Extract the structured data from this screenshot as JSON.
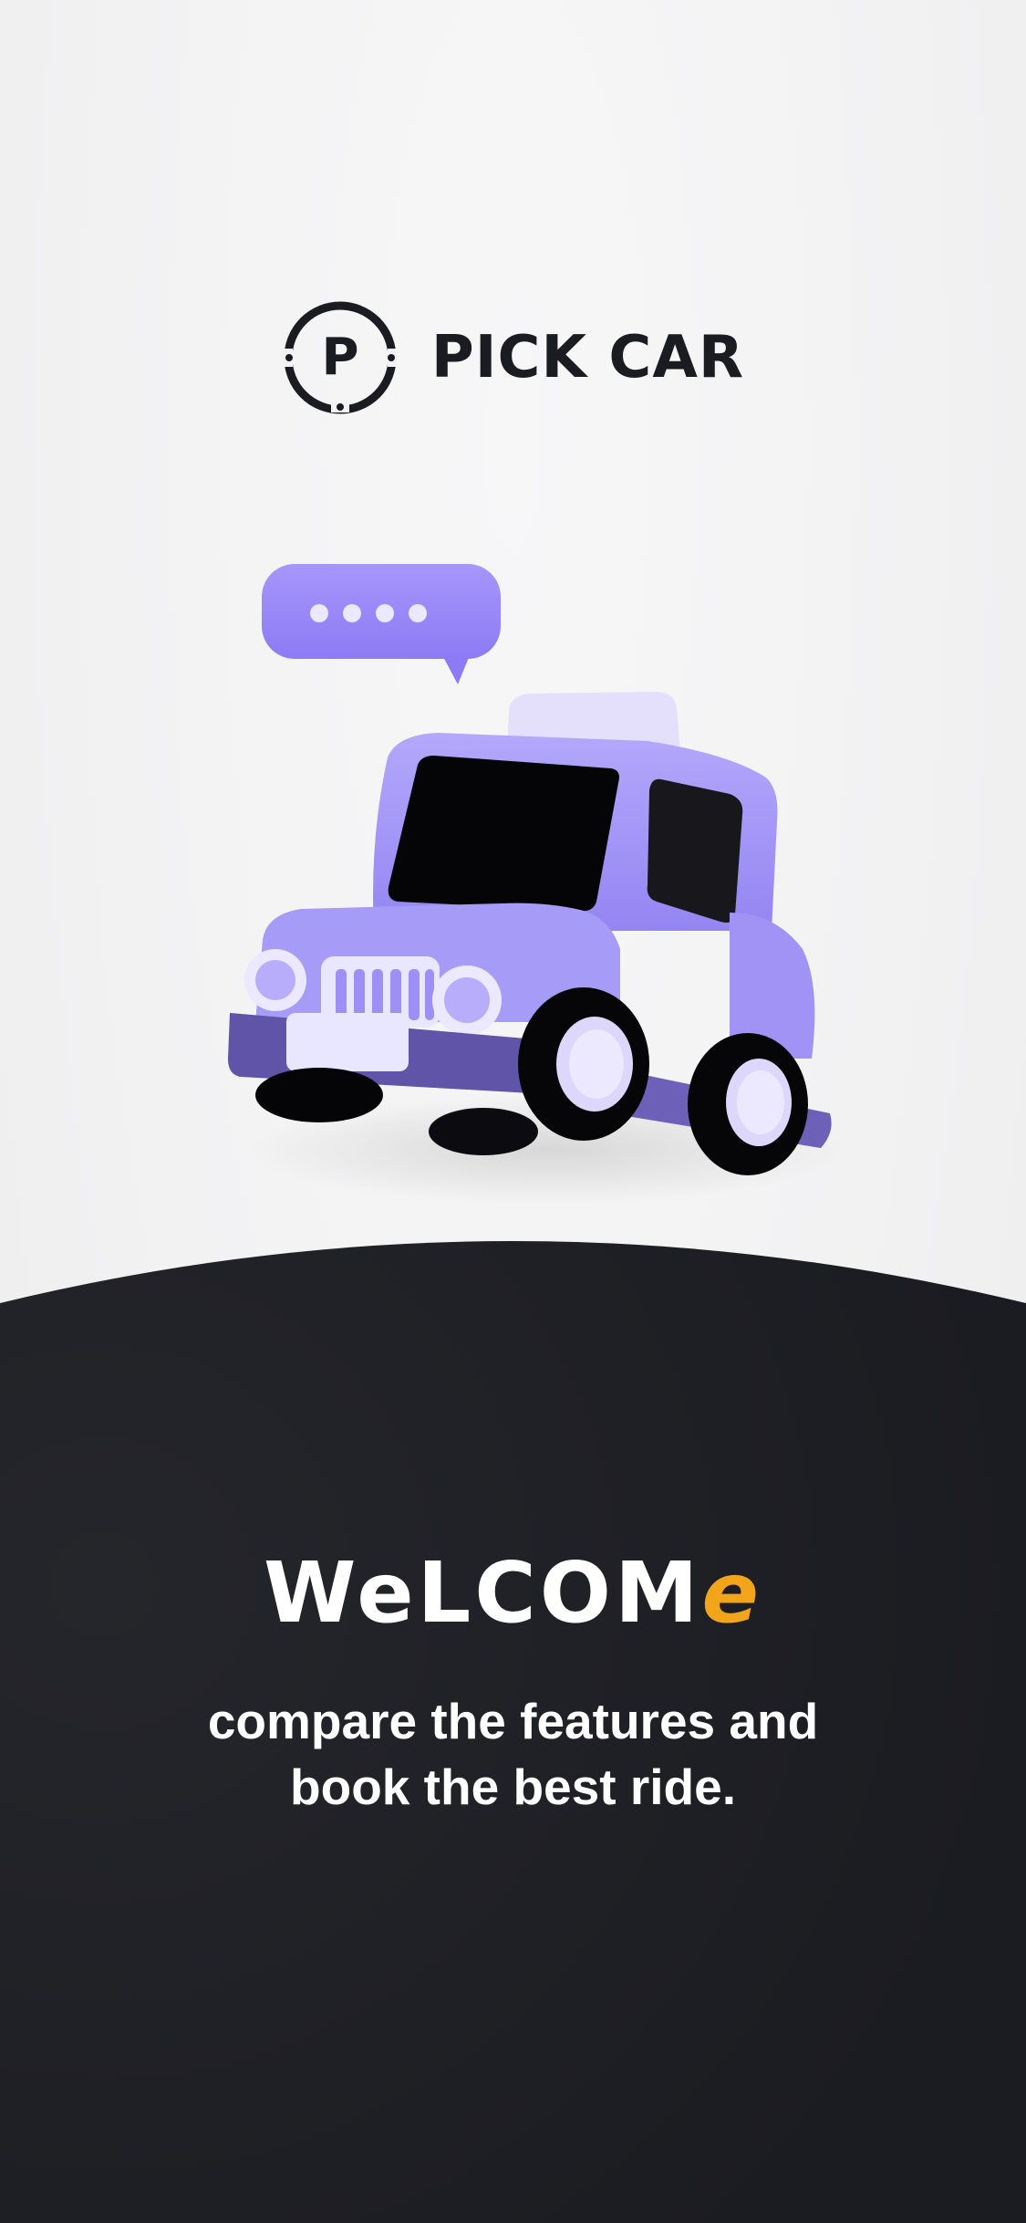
{
  "brand": {
    "name": "PICK CAR",
    "mark_letter": "P",
    "logo_icon": "steering-wheel-p-icon"
  },
  "illustration": {
    "icon": "car-with-chat-bubble-icon",
    "bubble_icon": "typing-dots-icon"
  },
  "welcome": {
    "main": "WeLCOM",
    "accent": "e",
    "accent_color": "#f2a51a"
  },
  "tagline": {
    "line1": "compare the features and",
    "line2": "book the best ride."
  },
  "colors": {
    "primary": "#9b8cf8",
    "dark": "#1b1c21",
    "background": "#f2f2f3"
  }
}
